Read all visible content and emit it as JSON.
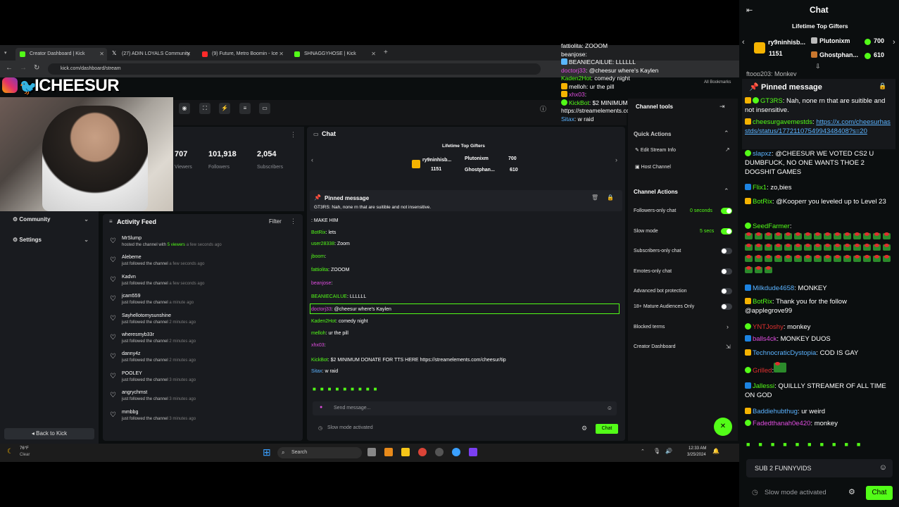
{
  "browser": {
    "tabs": [
      {
        "label": "Creator Dashboard | Kick",
        "color": "#53fc18",
        "active": true
      },
      {
        "label": "(27) ADIN LOYALS Community",
        "color": "#ffffff",
        "active": false
      },
      {
        "label": "(9) Future, Metro Boomin - Ice",
        "color": "#ff2a2a",
        "active": false
      },
      {
        "label": "SHNAGGYHOSE | Kick",
        "color": "#53fc18",
        "active": false
      }
    ],
    "new_tab": "+",
    "url": "kick.com/dashboard/stream",
    "all_bookmarks": "All Bookmarks"
  },
  "overlay": {
    "logo_text": "ICHEESUR",
    "chat_lines": [
      {
        "user": "fattiolita",
        "text": ": ZOOOM",
        "color": "#ffffff"
      },
      {
        "user": "beanjose",
        "text": ":",
        "color": "#ffffff"
      },
      {
        "user": "BEANIECAILUE",
        "text": ": LLLLLL",
        "color": "#ffffff"
      },
      {
        "user": "doctorj33",
        "text": ": @cheesur where's Kaylen",
        "color": "#e04de0"
      },
      {
        "user": "Kaden2Hot",
        "text": ": comedy night",
        "color": "#53fc18"
      },
      {
        "user": "melloh",
        "text": ": ur the pill",
        "color": "#ffffff"
      },
      {
        "user": "xhx03",
        "text": ":",
        "color": "#e04de0"
      },
      {
        "user": "KickBot",
        "text": ": $2 MINIMUM DONATE FOR TTS HERE",
        "color": "#53fc18"
      },
      {
        "user": "",
        "text": "https://streamelements.com/cheesur/tip",
        "color": "#ffffff"
      },
      {
        "user": "Sitax",
        "text": ": w raid",
        "color": "#5bb3ff"
      }
    ]
  },
  "dashboard": {
    "stats": [
      {
        "value": "707",
        "label": "Viewers"
      },
      {
        "value": "101,918",
        "label": "Followers"
      },
      {
        "value": "2,054",
        "label": "Subscribers"
      }
    ],
    "nav": [
      {
        "label": "Community"
      },
      {
        "label": "Settings"
      }
    ],
    "back_to_kick": "Back to Kick",
    "activity": {
      "title": "Activity Feed",
      "filter": "Filter",
      "items": [
        {
          "name": "MrSlump",
          "action": "hosted the channel with",
          "highlight": "5 viewers",
          "ago": "a few seconds ago"
        },
        {
          "name": "Alebeme",
          "action": "just followed the channel",
          "highlight": "",
          "ago": "a few seconds ago"
        },
        {
          "name": "Kadvn",
          "action": "just followed the channel",
          "highlight": "",
          "ago": "a few seconds ago"
        },
        {
          "name": "jcam559",
          "action": "just followed the channel",
          "highlight": "",
          "ago": "a minute ago"
        },
        {
          "name": "Sayhellotomysunshine",
          "action": "just followed the channel",
          "highlight": "",
          "ago": "2 minutes ago"
        },
        {
          "name": "wheresmyb33r",
          "action": "just followed the channel",
          "highlight": "",
          "ago": "2 minutes ago"
        },
        {
          "name": "danny4z",
          "action": "just followed the channel",
          "highlight": "",
          "ago": "2 minutes ago"
        },
        {
          "name": "POOLEY",
          "action": "just followed the channel",
          "highlight": "",
          "ago": "3 minutes ago"
        },
        {
          "name": "angrychmst",
          "action": "just followed the channel",
          "highlight": "",
          "ago": "3 minutes ago"
        },
        {
          "name": "mmbbg",
          "action": "just followed the channel",
          "highlight": "",
          "ago": "3 minutes ago"
        }
      ]
    },
    "chat": {
      "title": "Chat",
      "gifters_title": "Lifetime Top Gifters",
      "gifters": [
        {
          "name": "ry9ninhisb...",
          "amount": "1151"
        },
        {
          "name": "Plutonixm",
          "amount": "700"
        },
        {
          "name": "Ghostphan...",
          "amount": "610"
        }
      ],
      "pinned_label": "Pinned message",
      "pinned_text": "GT3RS: Nah, none rn that are suitible and not insensitive.",
      "messages": [
        {
          "user": "",
          "text": ": MAKE HIM",
          "color": "#e0302f"
        },
        {
          "user": "BotRix",
          "text": ": lets",
          "color": "#53fc18"
        },
        {
          "user": "user28338",
          "text": ": Zoom",
          "color": "#53fc18"
        },
        {
          "user": "jboom",
          "text": ":",
          "color": "#53fc18"
        },
        {
          "user": "fattiolita",
          "text": ": ZOOOM",
          "color": "#53fc18"
        },
        {
          "user": "beanjose",
          "text": ":",
          "color": "#e04de0"
        },
        {
          "user": "BEANIECAILUE",
          "text": ": LLLLLL",
          "color": "#53fc18"
        },
        {
          "user": "doctorj33",
          "text": ": @cheesur where's Kaylen",
          "color": "#e04de0"
        },
        {
          "user": "Kaden2Hot",
          "text": ": comedy night",
          "color": "#53fc18"
        },
        {
          "user": "melloh",
          "text": ": ur the pill",
          "color": "#53fc18"
        },
        {
          "user": "xhx03",
          "text": ":",
          "color": "#e04de0"
        },
        {
          "user": "KickBot",
          "text": ": $2 MINIMUM DONATE FOR TTS HERE https://streamelements.com/cheesur/tip",
          "color": "#53fc18"
        },
        {
          "user": "Sitax",
          "text": ": w raid",
          "color": "#5bb3ff"
        }
      ],
      "input_placeholder": "Send message...",
      "slow_mode": "Slow mode activated",
      "send": "Chat"
    },
    "channel_tools": {
      "title": "Channel tools",
      "quick_actions": "Quick Actions",
      "edit_stream_info": "Edit Stream Info",
      "host_channel": "Host Channel",
      "channel_actions": "Channel Actions",
      "toggles": [
        {
          "label": "Followers-only chat",
          "value": "0 seconds",
          "on": true
        },
        {
          "label": "Slow mode",
          "value": "5 secs",
          "on": true
        },
        {
          "label": "Subscribers-only chat",
          "value": "",
          "on": false
        },
        {
          "label": "Emotes-only chat",
          "value": "",
          "on": false
        },
        {
          "label": "Advanced bot protection",
          "value": "",
          "on": false
        },
        {
          "label": "18+ Mature Audiences Only",
          "value": "",
          "on": false
        }
      ],
      "blocked_terms": "Blocked terms",
      "creator_dashboard": "Creator Dashboard"
    }
  },
  "taskbar": {
    "weather_temp": "76°F",
    "weather_desc": "Clear",
    "search": "Search",
    "time": "12:33 AM",
    "date": "3/25/2024"
  },
  "right_chat": {
    "title": "Chat",
    "gifters_title": "Lifetime Top Gifters",
    "gifters": [
      {
        "name": "ry9ninhisb...",
        "amount": "1151"
      },
      {
        "name": "Plutonixm",
        "amount": "700"
      },
      {
        "name": "Ghostphan...",
        "amount": "610"
      }
    ],
    "partial_top": "ftoop203: Monkey",
    "pinned_label": "Pinned message",
    "pinned_user": "GT3RS",
    "pinned_text": ": Nah, none rn that are suitible and not insensitive.",
    "messages": [
      {
        "user": "cheesurgavemestds",
        "text": ": ",
        "link": "https://x.com/cheesurhasstds/status/1772110754994348408?s=20",
        "color": "#53fc18"
      },
      {
        "user": "slapxz",
        "text": ": @CHEESUR WE VOTED CS2 U DUMBFUCK, NO ONE WANTS THOE 2 DOGSHIT GAMES",
        "link": "",
        "color": "#5bb3ff"
      },
      {
        "user": "Flix1",
        "text": ": zo,bies",
        "link": "",
        "color": "#53fc18"
      },
      {
        "user": "BotRix",
        "text": ": @Kooperr you leveled up to Level 23",
        "link": "",
        "color": "#53fc18"
      },
      {
        "user": "SeedFarmer",
        "text": ":",
        "link": "",
        "color": "#53fc18"
      },
      {
        "user": "Milkdude4658",
        "text": ": MONKEY",
        "link": "",
        "color": "#5bb3ff"
      },
      {
        "user": "BotRix",
        "text": ": Thank you for the follow @applegrove99",
        "link": "",
        "color": "#53fc18"
      },
      {
        "user": "YNTJoshy",
        "text": ": monkey",
        "link": "",
        "color": "#e0302f"
      },
      {
        "user": "balls4ck",
        "text": ": MONKEY DUOS",
        "link": "",
        "color": "#e04de0"
      },
      {
        "user": "TechnocraticDystopia",
        "text": ": COD IS GAY",
        "link": "",
        "color": "#5bb3ff"
      },
      {
        "user": "Grilled",
        "text": ":",
        "link": "",
        "color": "#e0302f"
      },
      {
        "user": "Jallessi",
        "text": ": QUILLLY STREAMER OF ALL TIME ON GOD",
        "link": "",
        "color": "#53fc18"
      },
      {
        "user": "Baddiehubthug",
        "text": ": ur weird",
        "link": "",
        "color": "#5bb3ff"
      },
      {
        "user": "Fadedthanah0e420",
        "text": ": monkey",
        "link": "",
        "color": "#e04de0"
      }
    ],
    "input_value": "SUB 2 FUNNYVIDS",
    "slow_mode": "Slow mode activated",
    "send": "Chat"
  }
}
